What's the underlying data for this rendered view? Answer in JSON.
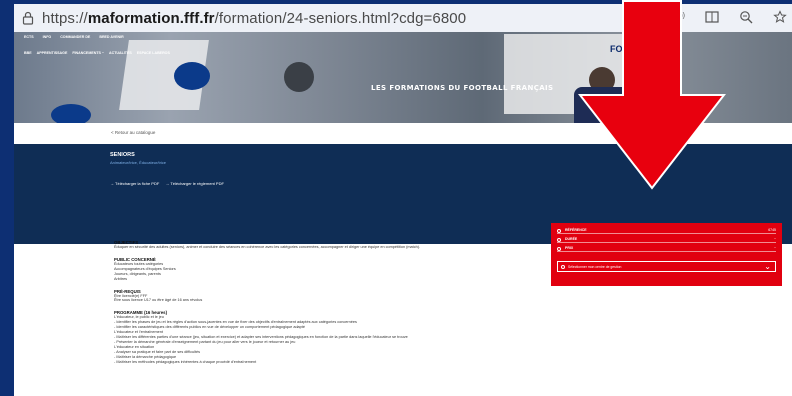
{
  "browser": {
    "url_prefix": "https://",
    "url_domain": "maformation.fff.fr",
    "url_path": "/formation/24-seniors.html?cdg=6800",
    "icons": [
      "lock-icon",
      "read-aloud-icon",
      "reader-view-icon",
      "zoom-icon",
      "favorites-icon"
    ]
  },
  "hero": {
    "title": "LES FORMATIONS DU FOOTBALL FRANÇAIS",
    "panel_word": "FORMATI",
    "nav_top": [
      "ECTS",
      "INFO",
      "COMMANDER DE",
      "BRED AVENIR"
    ],
    "nav_sub": [
      "BBE",
      "APPRENTISSAGE",
      "FINANCEMENTS ~",
      "ACTUALITÉS",
      "ESPACE LABEROS"
    ]
  },
  "breadcrumb": "< Retour au catalogue",
  "band": {
    "title": "SENIORS",
    "subtitle": "Animateur/trice, Éducateur/trice",
    "links": [
      "→ Télécharger la fiche PDF",
      "→ Télécharger le règlement PDF"
    ]
  },
  "sections": [
    {
      "title": "OBJECTIFS",
      "lines": [
        "Éduquer en sécurité des adultes (seniors), animer et conduire des séances en cohérence avec les catégories concernées, accompagner et diriger une équipe en compétition (match)."
      ]
    },
    {
      "title": "PUBLIC CONCERNÉ",
      "lines": [
        "Éducateurs toutes catégories",
        "Accompagnateurs d'équipes Seniors",
        "Joueurs, dirigeants, parents",
        "Arbitres"
      ]
    },
    {
      "title": "PRÉ-REQUIS",
      "lines": [
        "Être licencié(e) FFF",
        "Être sous licence U17 ou être âgé de 16 ans révolus"
      ]
    },
    {
      "title": "PROGRAMME (16 heures)",
      "lines": [
        "L'éducateur, le public et le jeu",
        "- Identifier les phases de jeu et les règles d'action sous-jacentes en vue de fixer des objectifs d'entraînement adaptés aux catégories concernées",
        "- Identifier les caractéristiques des différents publics en vue de développer un comportement pédagogique adapté",
        "L'éducateur et l'entraînement",
        "- Maîtriser les différentes parties d'une séance (jeu, situation et exercice) et adapter ses interventions pédagogiques en fonction de la partie dans laquelle l'éducateur se trouve",
        "- Présenter la démarche générale d'enseignement partant du jeu pour aller vers le joueur et retourner au jeu",
        "L'éducateur en situation",
        "- Analyser sa pratique et faire part de ses difficultés",
        "- Maîtriser la démarche pédagogique",
        "- Maîtriser les méthodes pédagogiques inhérentes à chaque procédé d'entraînement"
      ]
    }
  ],
  "red_panel": {
    "rows": [
      {
        "key": "RÉFÉRENCE",
        "value": "6745"
      },
      {
        "key": "DURÉE",
        "value": "~"
      },
      {
        "key": "PRIX",
        "value": "~"
      }
    ],
    "select_label": "Sélectionner mon centre de gestion"
  },
  "annotation": {
    "arrow_color": "#e8000e",
    "arrow_outline": "#ffffff"
  },
  "colors": {
    "page_border": "#0d2f73",
    "band": "#0f2d55",
    "panel": "#e1000f"
  }
}
